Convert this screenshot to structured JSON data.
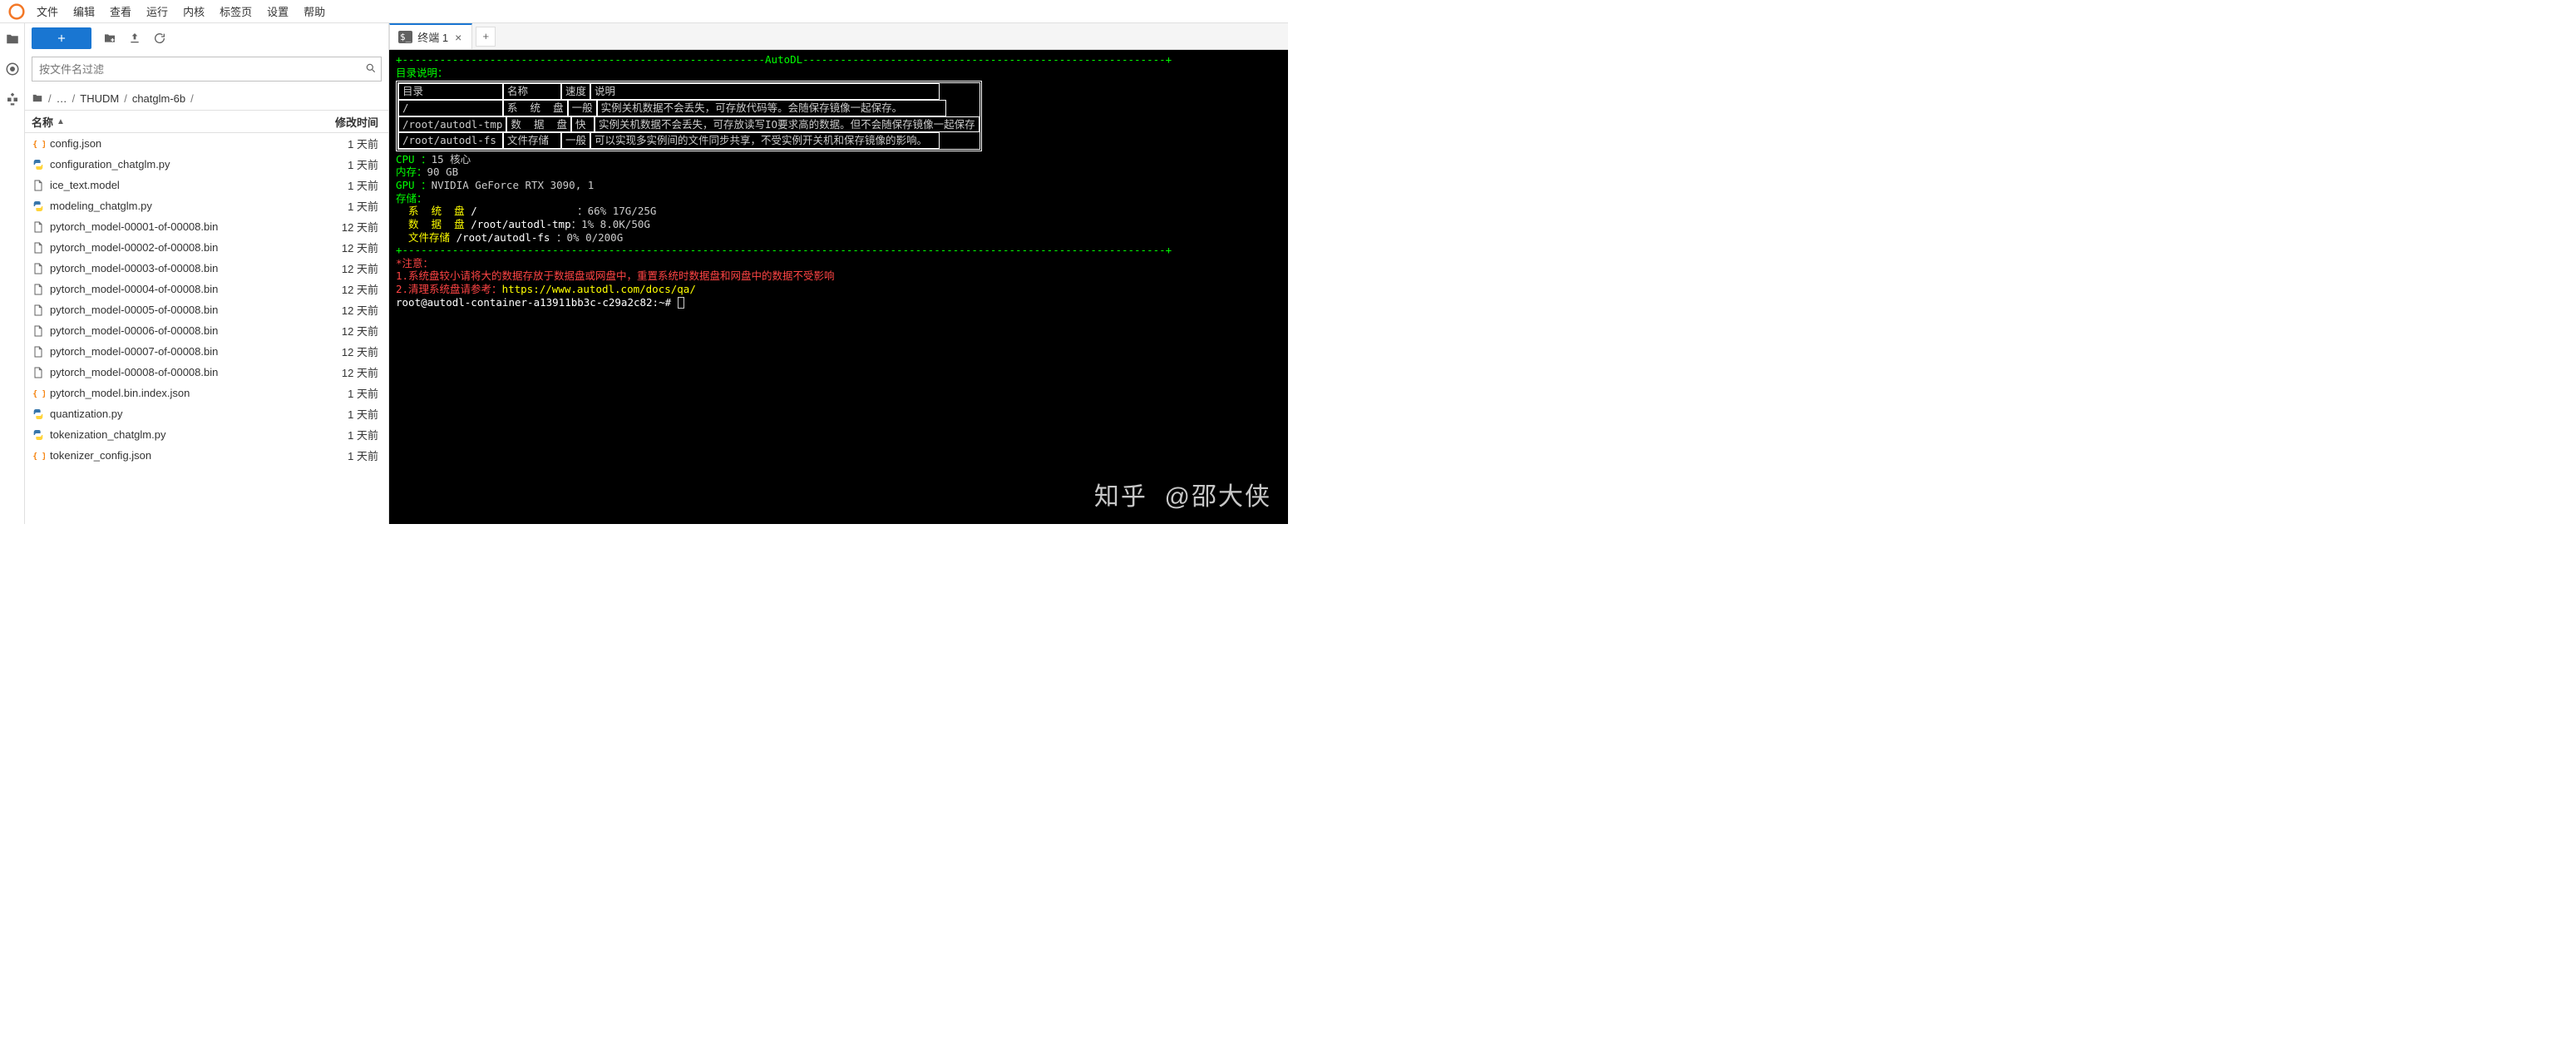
{
  "menu": [
    "文件",
    "编辑",
    "查看",
    "运行",
    "内核",
    "标签页",
    "设置",
    "帮助"
  ],
  "sidebar": {
    "filter_placeholder": "按文件名过滤",
    "breadcrumb": [
      "…",
      "THUDM",
      "chatglm-6b"
    ],
    "header_name": "名称",
    "header_mod": "修改时间"
  },
  "files": [
    {
      "icon": "json",
      "name": "config.json",
      "mod": "1 天前"
    },
    {
      "icon": "py",
      "name": "configuration_chatglm.py",
      "mod": "1 天前"
    },
    {
      "icon": "file",
      "name": "ice_text.model",
      "mod": "1 天前"
    },
    {
      "icon": "py",
      "name": "modeling_chatglm.py",
      "mod": "1 天前"
    },
    {
      "icon": "file",
      "name": "pytorch_model-00001-of-00008.bin",
      "mod": "12 天前"
    },
    {
      "icon": "file",
      "name": "pytorch_model-00002-of-00008.bin",
      "mod": "12 天前"
    },
    {
      "icon": "file",
      "name": "pytorch_model-00003-of-00008.bin",
      "mod": "12 天前"
    },
    {
      "icon": "file",
      "name": "pytorch_model-00004-of-00008.bin",
      "mod": "12 天前"
    },
    {
      "icon": "file",
      "name": "pytorch_model-00005-of-00008.bin",
      "mod": "12 天前"
    },
    {
      "icon": "file",
      "name": "pytorch_model-00006-of-00008.bin",
      "mod": "12 天前"
    },
    {
      "icon": "file",
      "name": "pytorch_model-00007-of-00008.bin",
      "mod": "12 天前"
    },
    {
      "icon": "file",
      "name": "pytorch_model-00008-of-00008.bin",
      "mod": "12 天前"
    },
    {
      "icon": "json",
      "name": "pytorch_model.bin.index.json",
      "mod": "1 天前"
    },
    {
      "icon": "py",
      "name": "quantization.py",
      "mod": "1 天前"
    },
    {
      "icon": "py",
      "name": "tokenization_chatglm.py",
      "mod": "1 天前"
    },
    {
      "icon": "json",
      "name": "tokenizer_config.json",
      "mod": "1 天前"
    }
  ],
  "tab": {
    "title": "终端 1"
  },
  "term": {
    "banner_title": "AutoDL",
    "dir_heading": "目录说明：",
    "table": {
      "headers": [
        "目录",
        "名称",
        "速度",
        "说明"
      ],
      "rows": [
        [
          "/",
          "系  统  盘",
          "一般",
          "实例关机数据不会丢失，可存放代码等。会随保存镜像一起保存。"
        ],
        [
          "/root/autodl-tmp",
          "数  据  盘",
          "快",
          "实例关机数据不会丢失，可存放读写IO要求高的数据。但不会随保存镜像一起保存"
        ],
        [
          "/root/autodl-fs",
          "文件存储",
          "一般",
          "可以实现多实例间的文件同步共享，不受实例开关机和保存镜像的影响。"
        ]
      ]
    },
    "cpu_label": "CPU ：",
    "cpu_val": "15 核心",
    "mem_label": "内存：",
    "mem_val": "90 GB",
    "gpu_label": "GPU ：",
    "gpu_val": "NVIDIA GeForce RTX 3090, 1",
    "storage_label": "存储：",
    "disk_sys_label": "  系  统  盘 ",
    "disk_sys_path": "/",
    "disk_sys_val": "：66% 17G/25G",
    "disk_data_label": "  数  据  盘 ",
    "disk_data_path": "/root/autodl-tmp",
    "disk_data_val": "：1% 8.0K/50G",
    "disk_fs_label": "  文件存储 ",
    "disk_fs_path": "/root/autodl-fs",
    "disk_fs_val": " ：0% 0/200G",
    "notice_head": "*注意：",
    "notice1": "1.系统盘较小请将大的数据存放于数据盘或网盘中，重置系统时数据盘和网盘中的数据不受影响",
    "notice2_pre": "2.清理系统盘请参考：",
    "notice2_url": "https://www.autodl.com/docs/qa/",
    "prompt": "root@autodl-container-a13911bb3c-c29a2c82:~# "
  },
  "watermark": "知乎  @邵大侠"
}
